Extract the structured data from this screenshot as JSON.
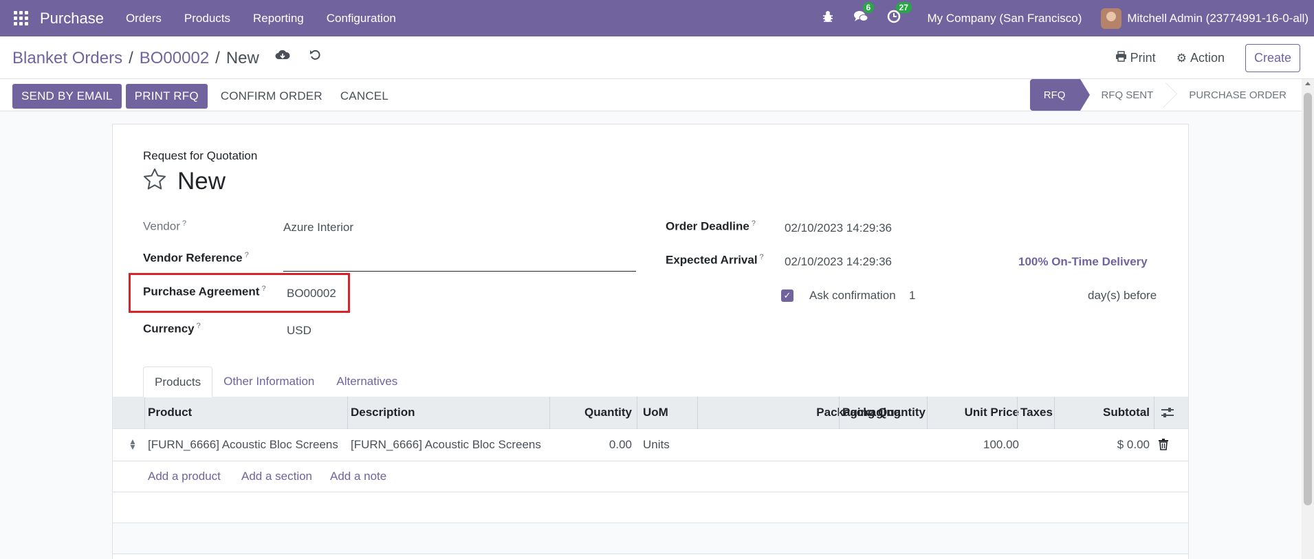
{
  "navbar": {
    "app_name": "Purchase",
    "menu": [
      "Orders",
      "Products",
      "Reporting",
      "Configuration"
    ],
    "messages_count": "6",
    "activities_count": "27",
    "company": "My Company (San Francisco)",
    "user": "Mitchell Admin (23774991-16-0-all)",
    "accent_color": "#71639e"
  },
  "breadcrumb": {
    "root": "Blanket Orders",
    "parent": "BO00002",
    "current": "New"
  },
  "control_panel": {
    "print_label": "Print",
    "action_label": "Action",
    "create_label": "Create"
  },
  "statusbar": {
    "buttons": {
      "send_email": "SEND BY EMAIL",
      "print_rfq": "PRINT RFQ",
      "confirm": "CONFIRM ORDER",
      "cancel": "CANCEL"
    },
    "stages": [
      "RFQ",
      "RFQ SENT",
      "PURCHASE ORDER"
    ],
    "active_stage": "RFQ"
  },
  "form": {
    "header_label": "Request for Quotation",
    "record_name": "New",
    "vendor_label": "Vendor",
    "vendor_value": "Azure Interior",
    "vendor_ref_label": "Vendor Reference",
    "vendor_ref_value": "",
    "agreement_label": "Purchase Agreement",
    "agreement_value": "BO00002",
    "currency_label": "Currency",
    "currency_value": "USD",
    "deadline_label": "Order Deadline",
    "deadline_value": "02/10/2023 14:29:36",
    "arrival_label": "Expected Arrival",
    "arrival_value": "02/10/2023 14:29:36",
    "ontime_label": "100% On-Time Delivery",
    "ask_confirmation_label": "Ask confirmation",
    "ask_confirmation_checked": true,
    "ask_confirmation_days": "1",
    "days_before_label": "day(s) before",
    "help_mark": "?"
  },
  "tabs": [
    "Products",
    "Other Information",
    "Alternatives"
  ],
  "table": {
    "columns": {
      "product": "Product",
      "description": "Description",
      "quantity": "Quantity",
      "uom": "UoM",
      "packaging_qty": "Packaging Quantity",
      "packaging": "Packaging",
      "unit_price": "Unit Price",
      "taxes": "Taxes",
      "subtotal": "Subtotal"
    },
    "rows": [
      {
        "product": "[FURN_6666] Acoustic Bloc Screens",
        "description": "[FURN_6666] Acoustic Bloc Screens",
        "quantity": "0.00",
        "uom": "Units",
        "packaging_qty": "",
        "packaging": "",
        "unit_price": "100.00",
        "taxes": "",
        "subtotal": "$ 0.00"
      }
    ],
    "add_product": "Add a product",
    "add_section": "Add a section",
    "add_note": "Add a note"
  }
}
